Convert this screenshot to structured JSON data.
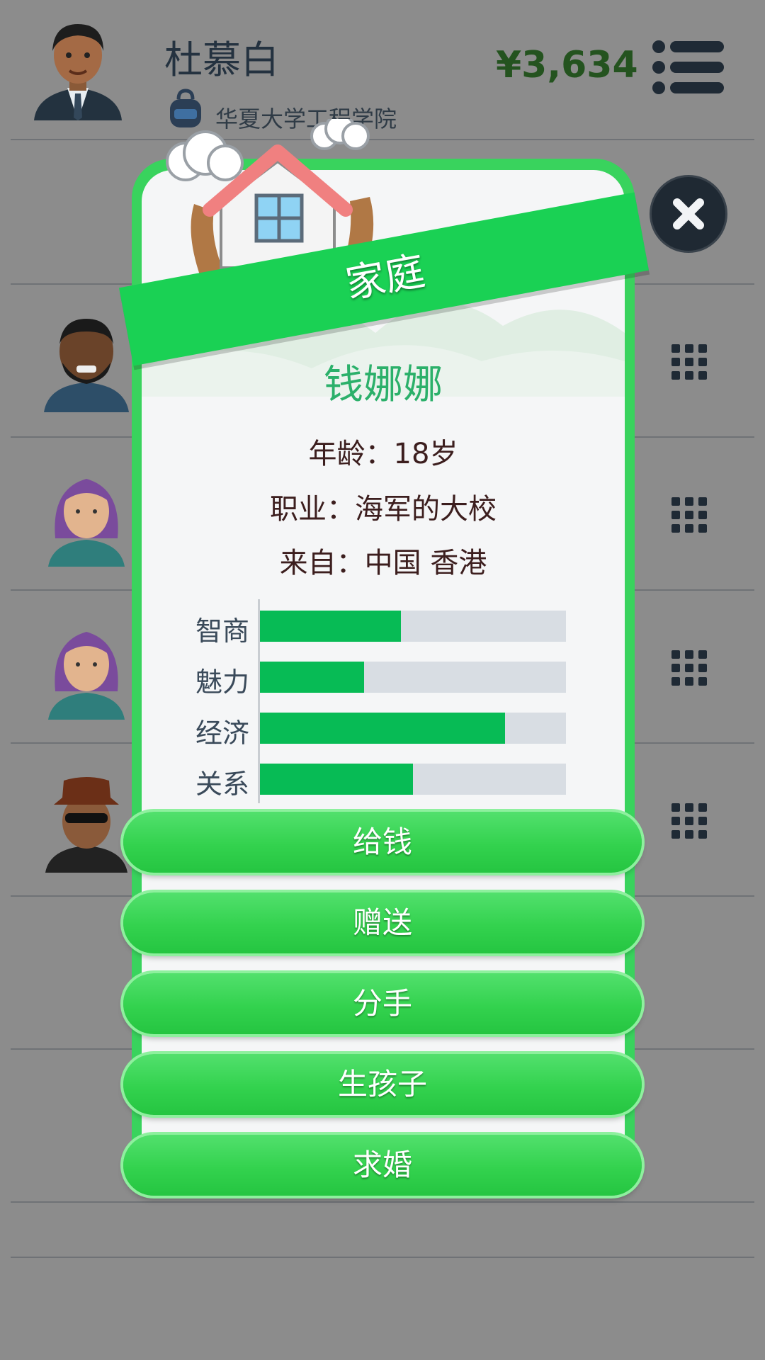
{
  "header": {
    "player_name": "杜慕白",
    "school": "华夏大学工程学院",
    "money": "¥3,634"
  },
  "modal": {
    "title": "家庭",
    "person": {
      "name": "钱娜娜",
      "age_line": "年龄：18岁",
      "job_line": "职业：海军的大校",
      "from_line": "来自：中国 香港"
    },
    "stats": [
      {
        "label": "智商",
        "value": 0.46
      },
      {
        "label": "魅力",
        "value": 0.34
      },
      {
        "label": "经济",
        "value": 0.8
      },
      {
        "label": "关系",
        "value": 0.5
      }
    ],
    "actions": [
      "给钱",
      "赠送",
      "分手",
      "生孩子",
      "求婚"
    ]
  },
  "colors": {
    "accent_green": "#1ad154",
    "bar_fill": "#07bb55",
    "name_color": "#2bb06a"
  }
}
